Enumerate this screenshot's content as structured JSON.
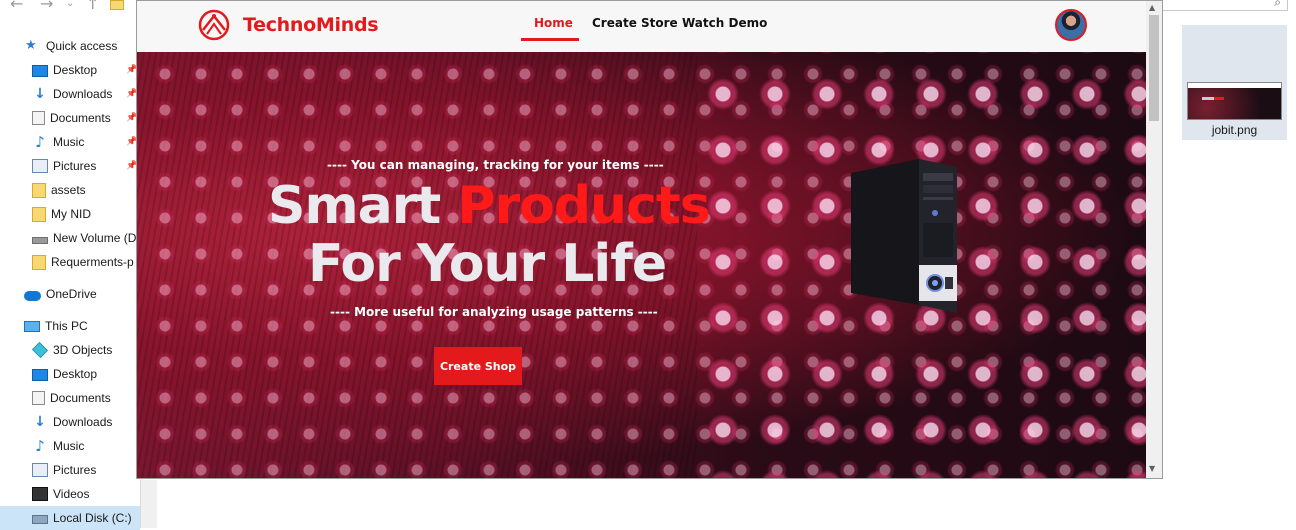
{
  "explorer": {
    "sidebar": [
      {
        "label": "Quick access",
        "icon": "star-icon",
        "pinned": false
      },
      {
        "label": "Desktop",
        "icon": "desktop-icon",
        "pinned": true
      },
      {
        "label": "Downloads",
        "icon": "download-icon",
        "pinned": true
      },
      {
        "label": "Documents",
        "icon": "document-icon",
        "pinned": true
      },
      {
        "label": "Music",
        "icon": "music-icon",
        "pinned": true
      },
      {
        "label": "Pictures",
        "icon": "pictures-icon",
        "pinned": true
      },
      {
        "label": "assets",
        "icon": "folder-icon",
        "pinned": false
      },
      {
        "label": "My NID",
        "icon": "folder-icon",
        "pinned": false
      },
      {
        "label": "New Volume (D:",
        "icon": "drive-icon",
        "pinned": false
      },
      {
        "label": "Requerments-p",
        "icon": "folder-icon",
        "pinned": false
      },
      {
        "label": "OneDrive",
        "icon": "cloud-icon",
        "pinned": false
      },
      {
        "label": "This PC",
        "icon": "computer-icon",
        "pinned": false
      },
      {
        "label": "3D Objects",
        "icon": "cube-icon",
        "pinned": false
      },
      {
        "label": "Desktop",
        "icon": "desktop-icon",
        "pinned": false
      },
      {
        "label": "Documents",
        "icon": "document-icon",
        "pinned": false
      },
      {
        "label": "Downloads",
        "icon": "download-icon",
        "pinned": false
      },
      {
        "label": "Music",
        "icon": "music-icon",
        "pinned": false
      },
      {
        "label": "Pictures",
        "icon": "pictures-icon",
        "pinned": false
      },
      {
        "label": "Videos",
        "icon": "video-icon",
        "pinned": false
      },
      {
        "label": "Local Disk (C:)",
        "icon": "disk-icon",
        "pinned": false
      }
    ],
    "file": {
      "name": "jobit.png"
    }
  },
  "site": {
    "brand": "TechnoMinds",
    "nav": {
      "home": "Home",
      "create_store": "Create Store",
      "watch_demo": "Watch Demo"
    },
    "hero": {
      "tagline_top": "---- You can managing, tracking for your items ----",
      "headline_line1_a": "Smart ",
      "headline_line1_b": "Products",
      "headline_line2": "For Your Life",
      "tagline_bottom": "---- More useful for analyzing usage patterns ----",
      "cta": "Create Shop"
    }
  },
  "colors": {
    "accent": "#e3191b",
    "hero_dark": "#1c0a12",
    "nav_bg": "#f7f7f7"
  }
}
